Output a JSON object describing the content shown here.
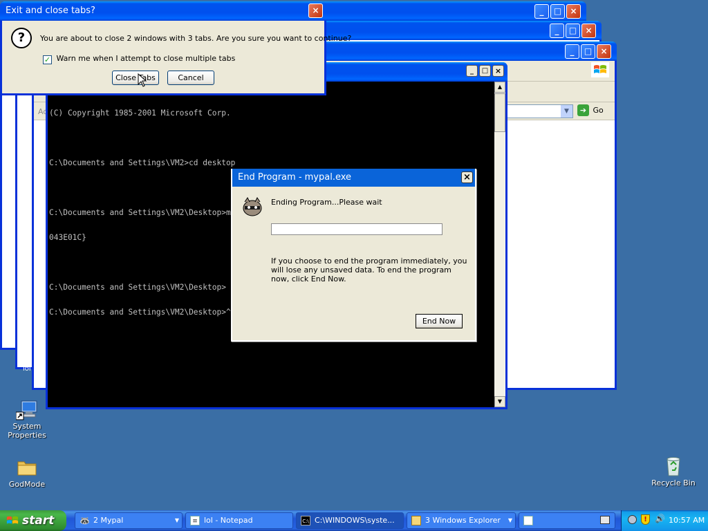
{
  "exit_dialog": {
    "title": "Exit and close tabs?",
    "message": "You are about to close 2 windows with 3 tabs. Are you sure you want to continue?",
    "checkbox_label": "Warn me when I attempt to close multiple tabs",
    "checkbox_checked": true,
    "close_tabs_label": "Close Tabs",
    "cancel_label": "Cancel"
  },
  "console": {
    "lines": [
      "(C) Copyright 1985-2001 Microsoft Corp.",
      "",
      "C:\\Documents and Settings\\VM2>cd desktop",
      "",
      "C:\\Documents and Settings\\VM2\\Desktop>md God Mode.{ED7BA470-8E54-465E-825C-99712",
      "043E01C}",
      "",
      "C:\\Documents and Settings\\VM2\\Desktop>",
      "C:\\Documents and Settings\\VM2\\Desktop>^R222"
    ]
  },
  "end_program": {
    "title": "End Program - mypal.exe",
    "status": "Ending Program...Please wait",
    "progress": 0,
    "info": "If you choose to end the program immediately, you will lose any unsaved data. To end the program now, click End Now.",
    "end_now_label": "End Now"
  },
  "explorer": {
    "go_label": "Go",
    "address_fragment": "Ad"
  },
  "desktop_icons": [
    {
      "label": "System Properties",
      "icon": "system-properties-icon"
    },
    {
      "label": "GodMode",
      "icon": "folder-icon"
    },
    {
      "label": "Recycle Bin",
      "icon": "recycle-bin-icon"
    }
  ],
  "taskbar": {
    "start_label": "start",
    "tasks": [
      {
        "label": "2 Mypal",
        "icon": "mypal-icon"
      },
      {
        "label": "lol - Notepad",
        "icon": "notepad-icon"
      },
      {
        "label": "C:\\WINDOWS\\syste...",
        "icon": "cmd-icon"
      },
      {
        "label": "3 Windows Explorer",
        "icon": "folder-icon"
      }
    ],
    "clock": "10:57 AM"
  },
  "partial_label": "lol",
  "colors": {
    "desktop": "#3a6ea5",
    "title_blue": "#0054e3",
    "close_red": "#c2350f",
    "taskbar": "#2457d5",
    "start_green": "#3c9a3c"
  }
}
